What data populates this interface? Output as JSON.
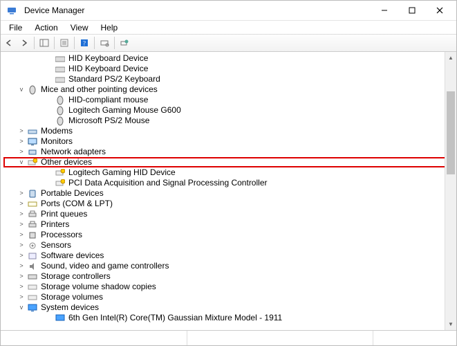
{
  "window": {
    "title": "Device Manager"
  },
  "menu": {
    "file": "File",
    "action": "Action",
    "view": "View",
    "help": "Help"
  },
  "tree": {
    "hid_keyboard_1": "HID Keyboard Device",
    "hid_keyboard_2": "HID Keyboard Device",
    "standard_ps2_kb": "Standard PS/2 Keyboard",
    "mice_category": "Mice and other pointing devices",
    "hid_mouse": "HID-compliant mouse",
    "logitech_mouse": "Logitech Gaming Mouse G600",
    "ms_ps2_mouse": "Microsoft PS/2 Mouse",
    "modems": "Modems",
    "monitors": "Monitors",
    "network_adapters": "Network adapters",
    "other_devices": "Other devices",
    "logitech_hid": "Logitech Gaming HID Device",
    "pci_daq": "PCI Data Acquisition and Signal Processing Controller",
    "portable_devices": "Portable Devices",
    "ports": "Ports (COM & LPT)",
    "print_queues": "Print queues",
    "printers": "Printers",
    "processors": "Processors",
    "sensors": "Sensors",
    "software_devices": "Software devices",
    "sound": "Sound, video and game controllers",
    "storage_controllers": "Storage controllers",
    "storage_shadow": "Storage volume shadow copies",
    "storage_volumes": "Storage volumes",
    "system_devices": "System devices",
    "sixth_gen": "6th Gen Intel(R) Core(TM) Gaussian Mixture Model - 1911"
  }
}
